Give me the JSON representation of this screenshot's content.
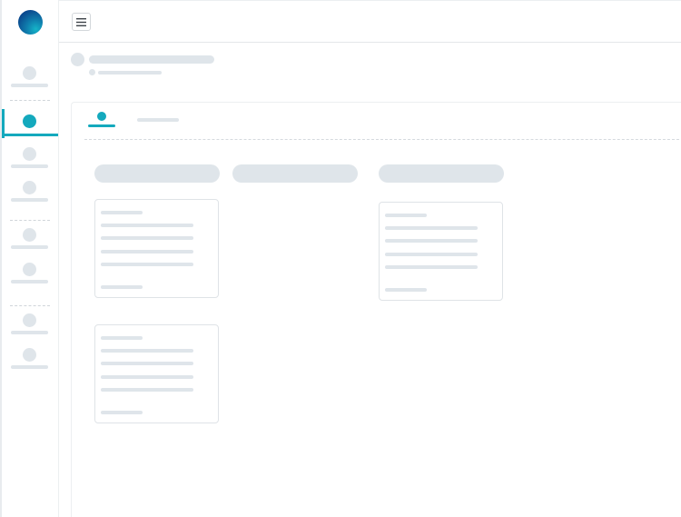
{
  "app": {
    "logo": "brand-logo",
    "colors": {
      "accent": "#14a9bd",
      "placeholder": "#dfe5ea",
      "border": "#dfe3e7"
    }
  },
  "sidebar": {
    "items": [
      {
        "state": "placeholder"
      },
      {
        "state": "active"
      },
      {
        "state": "placeholder"
      },
      {
        "state": "placeholder"
      },
      {
        "state": "placeholder"
      },
      {
        "state": "placeholder"
      },
      {
        "state": "placeholder"
      },
      {
        "state": "placeholder"
      }
    ]
  },
  "topbar": {
    "menu_icon": "hamburger-icon"
  },
  "content": {
    "state": "loading-skeleton",
    "tabs": [
      {
        "state": "active"
      },
      {
        "state": "placeholder"
      }
    ],
    "cards": 3
  }
}
